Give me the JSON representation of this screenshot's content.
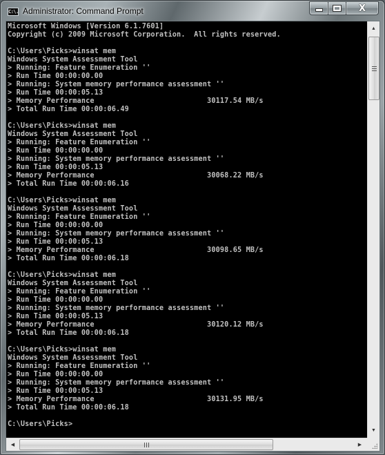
{
  "window": {
    "title": "Administrator: Command Prompt",
    "icon": "cmd-icon",
    "icon_text": "C:\\.",
    "controls": {
      "minimize": "minimize-icon",
      "maximize": "maximize-icon",
      "close": "close-icon",
      "close_glyph": "X"
    }
  },
  "console": {
    "colors": {
      "background": "#000000",
      "foreground": "#c0c0c0"
    },
    "header": [
      "Microsoft Windows [Version 6.1.7601]",
      "Copyright (c) 2009 Microsoft Corporation.  All rights reserved."
    ],
    "runs": [
      {
        "prompt": "C:\\Users\\Picks>winsat mem",
        "lines": [
          "Windows System Assessment Tool",
          "> Running: Feature Enumeration ''",
          "> Run Time 00:00:00.00",
          "> Running: System memory performance assessment ''",
          "> Run Time 00:00:05.13",
          "> Memory Performance                          30117.54 MB/s",
          "> Total Run Time 00:00:06.49"
        ]
      },
      {
        "prompt": "C:\\Users\\Picks>winsat mem",
        "lines": [
          "Windows System Assessment Tool",
          "> Running: Feature Enumeration ''",
          "> Run Time 00:00:00.00",
          "> Running: System memory performance assessment ''",
          "> Run Time 00:00:05.13",
          "> Memory Performance                          30068.22 MB/s",
          "> Total Run Time 00:00:06.16"
        ]
      },
      {
        "prompt": "C:\\Users\\Picks>winsat mem",
        "lines": [
          "Windows System Assessment Tool",
          "> Running: Feature Enumeration ''",
          "> Run Time 00:00:00.00",
          "> Running: System memory performance assessment ''",
          "> Run Time 00:00:05.13",
          "> Memory Performance                          30098.65 MB/s",
          "> Total Run Time 00:00:06.18"
        ]
      },
      {
        "prompt": "C:\\Users\\Picks>winsat mem",
        "lines": [
          "Windows System Assessment Tool",
          "> Running: Feature Enumeration ''",
          "> Run Time 00:00:00.00",
          "> Running: System memory performance assessment ''",
          "> Run Time 00:00:05.13",
          "> Memory Performance                          30120.12 MB/s",
          "> Total Run Time 00:00:06.18"
        ]
      },
      {
        "prompt": "C:\\Users\\Picks>winsat mem",
        "lines": [
          "Windows System Assessment Tool",
          "> Running: Feature Enumeration ''",
          "> Run Time 00:00:00.00",
          "> Running: System memory performance assessment ''",
          "> Run Time 00:00:05.13",
          "> Memory Performance                          30131.95 MB/s",
          "> Total Run Time 00:00:06.18"
        ]
      }
    ],
    "current_prompt": "C:\\Users\\Picks>"
  },
  "scrollbars": {
    "vertical": {
      "up_arrow": "▲",
      "down_arrow": "▼",
      "position_fraction": 0.0
    },
    "horizontal": {
      "left_arrow": "◀",
      "right_arrow": "▶",
      "position_fraction": 0.0
    }
  }
}
